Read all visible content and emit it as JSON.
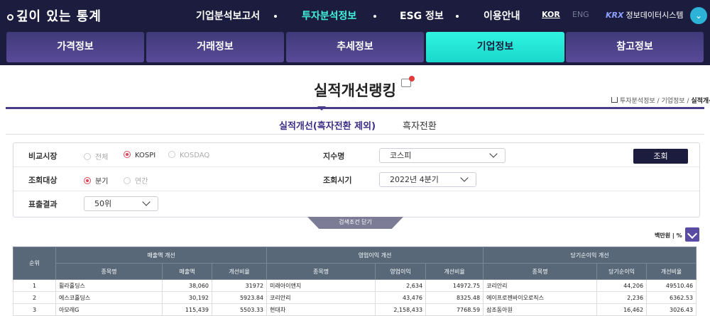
{
  "brand": {
    "logo_text": "깊이 있는 통계"
  },
  "top_nav": [
    {
      "label": "기업분석보고서",
      "active": false
    },
    {
      "label": "투자분석정보",
      "active": true
    },
    {
      "label": "ESG 정보",
      "active": false
    },
    {
      "label": "이용안내",
      "active": false
    }
  ],
  "lang": {
    "kor": "KOR",
    "eng": "ENG"
  },
  "krx": {
    "mark": "KRX",
    "label": "정보데이터시스템"
  },
  "tabs": [
    {
      "label": "가격정보",
      "active": false
    },
    {
      "label": "거래정보",
      "active": false
    },
    {
      "label": "추세정보",
      "active": false
    },
    {
      "label": "기업정보",
      "active": true
    },
    {
      "label": "참고정보",
      "active": false
    }
  ],
  "page": {
    "title": "실적개선랭킹"
  },
  "breadcrumb": {
    "part1": "투자분석정보",
    "part2": "기업정보",
    "current": "실적개선랭킹"
  },
  "subtabs": [
    {
      "label": "실적개선(흑자전환 제외)",
      "active": true
    },
    {
      "label": "흑자전환",
      "active": false
    }
  ],
  "filter": {
    "market_label": "비교시장",
    "market_options": [
      {
        "label": "전체",
        "selected": false
      },
      {
        "label": "KOSPI",
        "selected": true
      },
      {
        "label": "KOSDAQ",
        "selected": false
      }
    ],
    "index_label": "지수명",
    "index_value": "코스피",
    "search_button": "조회",
    "target_label": "조회대상",
    "target_options": [
      {
        "label": "분기",
        "selected": true
      },
      {
        "label": "연간",
        "selected": false
      }
    ],
    "period_label": "조회시기",
    "period_value": "2022년 4분기",
    "result_label": "표출결과",
    "result_value": "50위",
    "close_label": "검색조건 닫기"
  },
  "unit": {
    "label": "백만원",
    "sep": "|",
    "percent": "%"
  },
  "table": {
    "rank_header": "순위",
    "groups": [
      "매출액 개선",
      "영업이익 개선",
      "당기순이익 개선"
    ],
    "sub_headers": [
      "종목명",
      "매출액",
      "개선비율",
      "종목명",
      "영업이익",
      "개선비율",
      "종목명",
      "당기순이익",
      "개선비율"
    ],
    "rows": [
      [
        "1",
        "휠라홀딩스",
        "38,060",
        "31972",
        "미래아이앤지",
        "2,634",
        "14972.75",
        "코리안리",
        "44,206",
        "49510.46"
      ],
      [
        "2",
        "에스코홀딩스",
        "30,192",
        "5923.84",
        "코리안리",
        "43,476",
        "8325.48",
        "에이프로젠바이오로직스",
        "2,236",
        "6362.53"
      ],
      [
        "3",
        "아모레G",
        "115,439",
        "5503.33",
        "현대차",
        "2,158,433",
        "7768.59",
        "삼조동아원",
        "16,462",
        "3026.43"
      ]
    ]
  }
}
